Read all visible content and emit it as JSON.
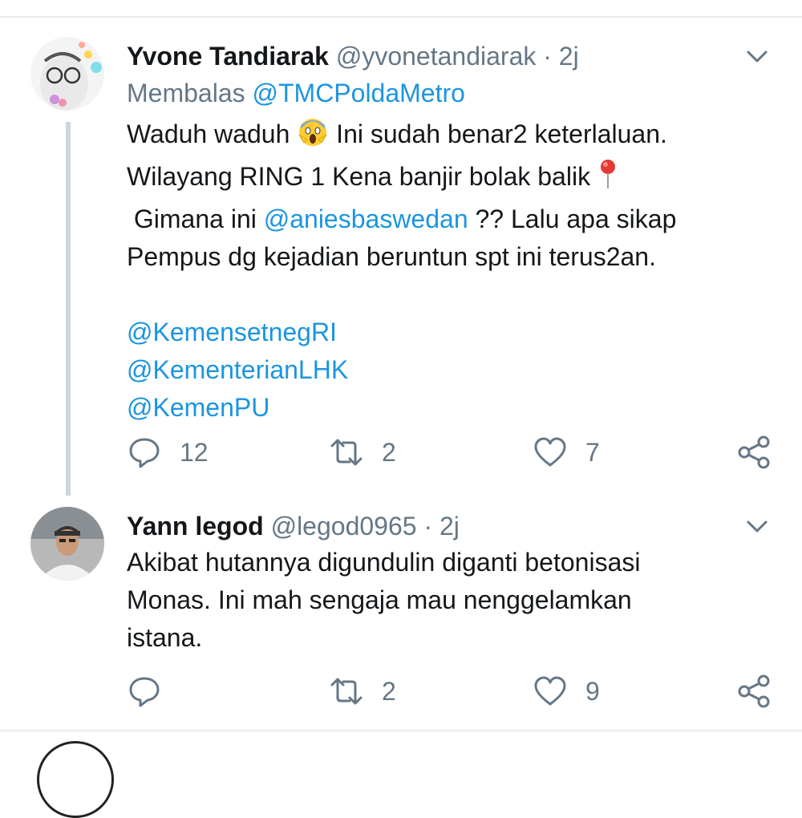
{
  "tweets": [
    {
      "name": "Yvone Tandiarak",
      "handle": "@yvonetandiarak",
      "separator": "·",
      "time": "2j",
      "reply_prefix": "Membalas",
      "reply_to": "@TMCPoldaMetro",
      "lines": {
        "l1a": "Waduh waduh",
        "l1b": "Ini sudah benar2 keterlaluan.",
        "l2": "Wilayang RING 1 Kena banjir bolak balik",
        "l3a": "Gimana ini",
        "l3mention": "@aniesbaswedan",
        "l3b": "?? Lalu apa sikap",
        "l4": "Pempus dg kejadian beruntun spt ini terus2an.",
        "m1": "@KemensetnegRI",
        "m2": "@KementerianLHK",
        "m3": "@KemenPU"
      },
      "emoji": [
        "face-screaming-in-fear",
        "round-pushpin"
      ],
      "replies": "12",
      "retweets": "2",
      "likes": "7"
    },
    {
      "name": "Yann legod",
      "handle": "@legod0965",
      "separator": "·",
      "time": "2j",
      "lines": {
        "l1": "Akibat hutannya digundulin diganti betonisasi",
        "l2": "Monas. Ini mah sengaja mau nenggelamkan",
        "l3": "istana."
      },
      "replies": "",
      "retweets": "2",
      "likes": "9"
    }
  ],
  "icons": [
    "reply-icon",
    "retweet-icon",
    "like-icon",
    "share-icon",
    "chevron-down-icon"
  ],
  "colors": {
    "link": "#1b95e0",
    "muted": "#657786",
    "text": "#14171a",
    "divider": "#e6ecf0"
  }
}
